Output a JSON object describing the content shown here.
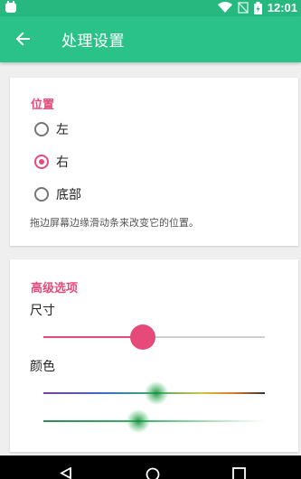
{
  "status_bar": {
    "time": "12:01",
    "icons": [
      "android-debug-icon",
      "wifi-icon",
      "no-sim-icon",
      "battery-charging-icon"
    ]
  },
  "toolbar": {
    "title": "处理设置",
    "back_icon": "arrow-back-icon"
  },
  "position_section": {
    "title": "位置",
    "options": [
      {
        "label": "左",
        "checked": false
      },
      {
        "label": "右",
        "checked": true
      },
      {
        "label": "底部",
        "checked": false
      }
    ],
    "hint": "拖边屏幕边缘滑动条来改变它的位置。"
  },
  "advanced_section": {
    "title": "高级选项",
    "size_label": "尺寸",
    "size_value_fraction": 0.45,
    "color_label": "颜色",
    "hue_value_fraction": 0.51,
    "brightness_value_fraction": 0.43
  },
  "nav_bar": {
    "icons": [
      "nav-back-icon",
      "nav-home-icon",
      "nav-recents-icon"
    ]
  },
  "colors": {
    "status_bar": "#26b87f",
    "toolbar": "#2bc28a",
    "accent": "#e64a7b",
    "background": "#efefef"
  }
}
